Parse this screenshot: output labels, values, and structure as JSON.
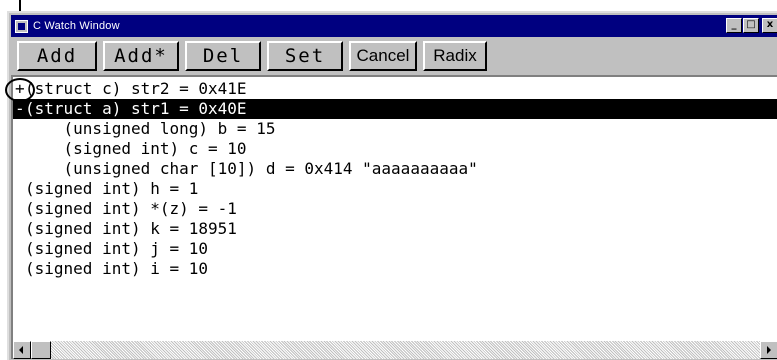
{
  "window": {
    "title": "C Watch Window",
    "minimize_glyph": "_",
    "maximize_glyph": "□",
    "close_glyph": "x"
  },
  "toolbar": {
    "add_label": "Add",
    "add_star_label": "Add*",
    "del_label": "Del",
    "set_label": "Set",
    "cancel_label": "Cancel",
    "radix_label": "Radix"
  },
  "watch_items": [
    {
      "sign": "+",
      "text": "(struct c) str2 = 0x41E",
      "indent": "",
      "selected": false
    },
    {
      "sign": "-",
      "text": "(struct a) str1 = 0x40E",
      "indent": "",
      "selected": true
    },
    {
      "sign": "",
      "text": "(unsigned long) b = 15",
      "indent": "    ",
      "selected": false
    },
    {
      "sign": "",
      "text": "(signed int) c = 10",
      "indent": "    ",
      "selected": false
    },
    {
      "sign": "",
      "text": "(unsigned char [10]) d = 0x414 \"aaaaaaaaaa\"",
      "indent": "    ",
      "selected": false
    },
    {
      "sign": "",
      "text": "(signed int) h = 1",
      "indent": "",
      "selected": false
    },
    {
      "sign": "",
      "text": "(signed int) *(z) = -1",
      "indent": "",
      "selected": false
    },
    {
      "sign": "",
      "text": "(signed int) k = 18951",
      "indent": "",
      "selected": false
    },
    {
      "sign": "",
      "text": "(signed int) j = 10",
      "indent": "",
      "selected": false
    },
    {
      "sign": "",
      "text": "(signed int) i = 10",
      "indent": "",
      "selected": false
    }
  ],
  "colors": {
    "titlebar": "#000080",
    "selection": "#000000",
    "face": "#c0c0c0"
  }
}
